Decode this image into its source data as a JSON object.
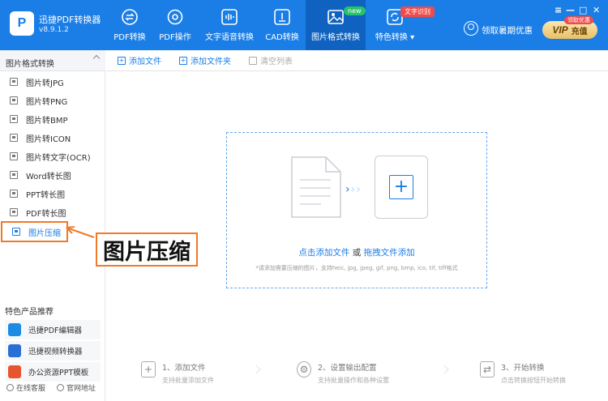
{
  "app": {
    "title": "迅捷PDF转换器",
    "version": "v8.9.1.2"
  },
  "nav": [
    {
      "label": "PDF转换",
      "icon": "exchange-icon"
    },
    {
      "label": "PDF操作",
      "icon": "gear-icon"
    },
    {
      "label": "文字语音转换",
      "icon": "audio-wave-icon"
    },
    {
      "label": "CAD转换",
      "icon": "cad-icon"
    },
    {
      "label": "图片格式转换",
      "icon": "image-icon"
    },
    {
      "label": "特色转换",
      "icon": "refresh-icon"
    }
  ],
  "badges": {
    "new": "new",
    "ocr": "文字识别"
  },
  "vip": {
    "text": "领取暑期优惠",
    "tag": "领取优惠",
    "button_vip": "VIP",
    "button_label": "充值"
  },
  "window": {
    "menu": "≡",
    "min": "—",
    "max": "□",
    "close": "✕"
  },
  "sidebar": {
    "header": "图片格式转换",
    "items": [
      {
        "label": "图片转JPG"
      },
      {
        "label": "图片转PNG"
      },
      {
        "label": "图片转BMP"
      },
      {
        "label": "图片转ICON"
      },
      {
        "label": "图片转文字(OCR)"
      },
      {
        "label": "Word转长图"
      },
      {
        "label": "PPT转长图"
      },
      {
        "label": "PDF转长图"
      },
      {
        "label": "图片压缩"
      }
    ],
    "recommend_title": "特色产品推荐",
    "recommend": [
      {
        "label": "迅捷PDF编辑器",
        "color": "#1b8be6"
      },
      {
        "label": "迅捷视频转换器",
        "color": "#2a6fd6"
      },
      {
        "label": "办公资源PPT模板",
        "color": "#e8542e"
      }
    ],
    "footer": {
      "service": "在线客服",
      "website": "官网地址"
    }
  },
  "toolbar": {
    "add_file": "添加文件",
    "add_folder": "添加文件夹",
    "clear": "清空列表"
  },
  "dropzone": {
    "main_prefix": "点击添加文件",
    "main_mid": " 或 ",
    "main_suffix": "拖拽文件添加",
    "note": "*请添加需要压缩的图片，支持heic, jpg, jpeg, gif, png, bmp, ico, tif, tiff格式"
  },
  "steps": [
    {
      "title": "1、添加文件",
      "desc": "支持批量添加文件"
    },
    {
      "title": "2、设置输出配置",
      "desc": "支持批量操作和各种设置"
    },
    {
      "title": "3、开始转换",
      "desc": "点击转换按钮开始转换"
    }
  ],
  "annotation": {
    "text": "图片压缩",
    "color": "#f07a2a"
  }
}
